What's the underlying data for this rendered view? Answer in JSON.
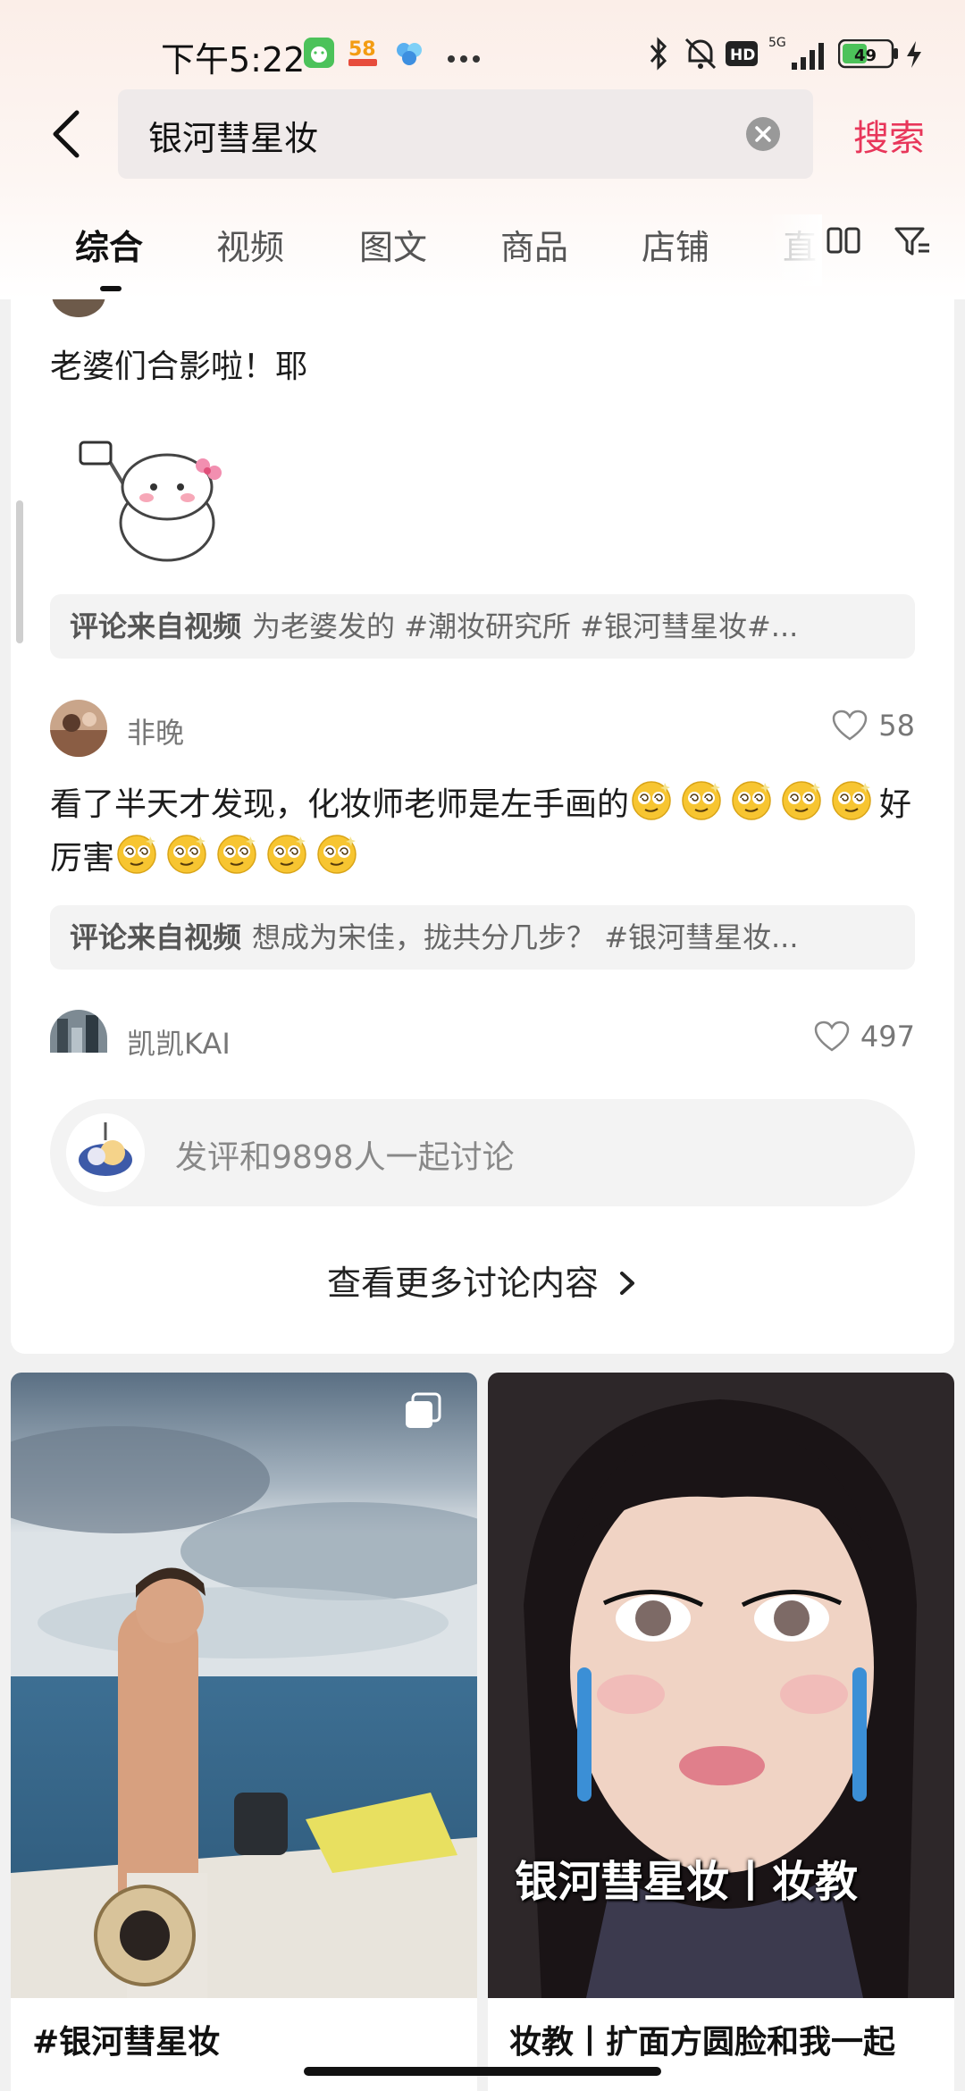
{
  "status_bar": {
    "time": "下午5:22",
    "network": "5G",
    "battery": "49",
    "icons": [
      "app-icon",
      "58-app-icon",
      "cloud-app-icon",
      "more-dots-icon",
      "bluetooth-icon",
      "mute-icon",
      "hd-icon",
      "signal-icon",
      "battery-icon",
      "charging-icon"
    ]
  },
  "search": {
    "query": "银河彗星妆",
    "button_label": "搜索"
  },
  "tabs": [
    {
      "label": "综合",
      "active": true
    },
    {
      "label": "视频"
    },
    {
      "label": "图文"
    },
    {
      "label": "商品"
    },
    {
      "label": "店铺"
    },
    {
      "label": "直"
    }
  ],
  "comments": [
    {
      "text": "老婆们合影啦！耶",
      "sticker": "selfie-sticker",
      "ref_label": "评论来自视频",
      "ref_text": "为老婆发的 #潮妆研究所 #银河彗星妆#..."
    },
    {
      "user": "非晚",
      "likes": "58",
      "text_part1": "看了半天才发现，化妆师老师是左手画的",
      "text_part2": "好厉害",
      "ref_label": "评论来自视频",
      "ref_text": "想成为宋佳，拢共分几步？ #银河彗星妆..."
    },
    {
      "user": "凯凯KAI",
      "likes": "497"
    }
  ],
  "comment_input": {
    "placeholder": "发评和9898人一起讨论"
  },
  "more_link": "查看更多讨论内容",
  "feed": [
    {
      "title": "#银河彗星妆",
      "badge": "multi-image-icon"
    },
    {
      "title": "妆教丨扩面方圆脸和我一起",
      "overlay": "银河彗星妆丨妆教"
    }
  ],
  "colors": {
    "accent": "#e8365a",
    "text": "#222222",
    "muted": "#777777"
  }
}
